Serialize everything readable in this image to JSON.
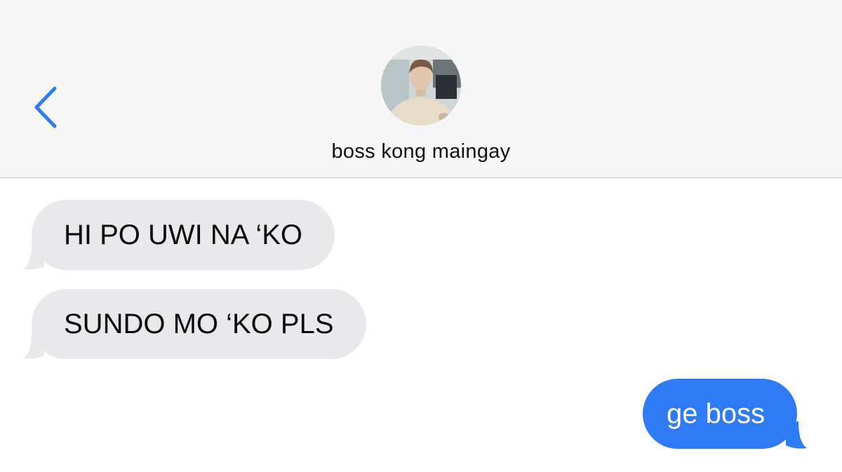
{
  "header": {
    "contact_name": "boss kong maingay",
    "back_icon": "chevron-left-icon",
    "accent_color": "#2f7bf5"
  },
  "messages": [
    {
      "direction": "received",
      "text": "HI PO UWI NA ‘KO"
    },
    {
      "direction": "received",
      "text": "SUNDO MO ‘KO PLS"
    },
    {
      "direction": "sent",
      "text": "ge boss"
    }
  ],
  "colors": {
    "header_bg": "#f6f6f6",
    "received_bubble": "#e9e9eb",
    "sent_bubble": "#2f7bf5"
  }
}
